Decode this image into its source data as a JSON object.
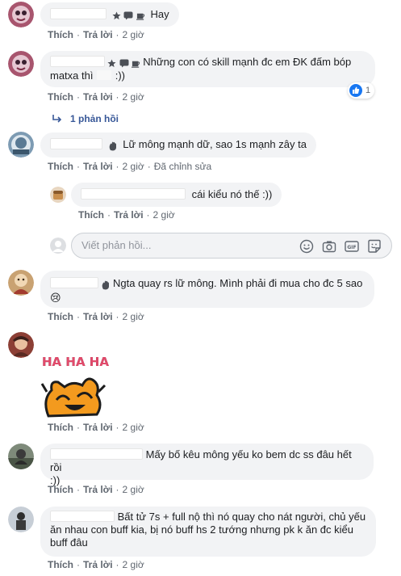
{
  "labels": {
    "like": "Thích",
    "reply": "Trả lời",
    "time": "2 giờ",
    "edited": "Đã chỉnh sửa"
  },
  "comments": [
    {
      "text": "Hay"
    },
    {
      "text_line1": "Những con có skill mạnh đc em ĐK đấm bóp",
      "text_line2_a": "matxa thì",
      "text_line2_b": ":))",
      "reaction_count": "1",
      "replies_link": "1 phản hồi"
    },
    {
      "text": "Lữ mông mạnh dữ, sao 1s mạnh zây ta"
    },
    {
      "text": "cái kiểu nó thế :))"
    },
    {
      "text_line1": "Ngta quay rs lữ mông. Mình phải đi mua cho đc 5 sao",
      "emoji": "😢"
    },
    {
      "sticker_text": "HA HA HA"
    },
    {
      "text_line1": "Mấy bố kêu mông yếu ko bem dc ss đâu hết rồi",
      "text_line2": ":))"
    },
    {
      "text_line1": "Bất tử 7s + full nộ thì nó quay cho nát người, chủ yếu",
      "text_line2": "ăn nhau con buff kia, bị nó buff hs 2 tướng nhưng pk k ăn đc kiểu",
      "text_line3": "buff đâu"
    }
  ],
  "composer": {
    "placeholder": "Viết phản hồi...",
    "icons": [
      "emoji-icon",
      "camera-icon",
      "gif-icon",
      "sticker-icon"
    ]
  },
  "colors": {
    "bubble": "#f2f3f5",
    "meta": "#606770",
    "link": "#385898",
    "like_blue": "#1877f2"
  }
}
